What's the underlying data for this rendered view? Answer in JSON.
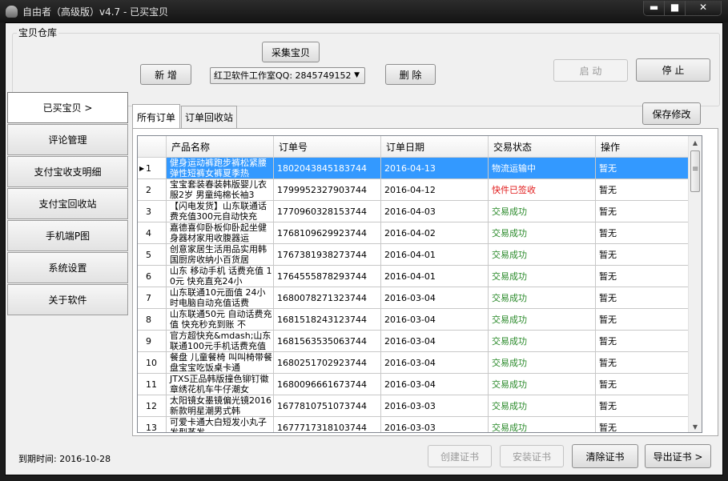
{
  "window": {
    "title": "自由者（高级版）v4.7 - 已买宝贝",
    "min_glyph": "▬",
    "max_glyph": "■",
    "close_glyph": "✕"
  },
  "header": {
    "group_title": "宝贝仓库",
    "collect_label": "采集宝贝",
    "add_label": "新 增",
    "shop_select_value": "红卫软件工作室QQ: 2845749152",
    "delete_label": "删 除",
    "start_label": "启 动",
    "stop_label": "停 止"
  },
  "sidebar": {
    "items": [
      {
        "label": "已买宝贝 >"
      },
      {
        "label": "评论管理"
      },
      {
        "label": "支付宝收支明细"
      },
      {
        "label": "支付宝回收站"
      },
      {
        "label": "手机端P图"
      },
      {
        "label": "系统设置"
      },
      {
        "label": "关于软件"
      }
    ],
    "active_index": 0
  },
  "tabs": [
    {
      "label": "所有订单"
    },
    {
      "label": "订单回收站"
    }
  ],
  "save_label": "保存修改",
  "grid": {
    "columns": [
      "产品名称",
      "订单号",
      "订单日期",
      "交易状态",
      "操作"
    ],
    "rows": [
      {
        "no": "1",
        "name": "健身运动裤跑步裤松紧腰弹性短裤女裤夏季热",
        "order": "1802043845183744",
        "date": "2016-04-13",
        "status": "物流运输中",
        "status_color": "green",
        "op": "暂无"
      },
      {
        "no": "2",
        "name": "宝宝套装春装韩版婴儿衣服2岁 男童纯棉长袖3",
        "order": "1799952327903744",
        "date": "2016-04-12",
        "status": "快件已签收",
        "status_color": "red",
        "op": "暂无"
      },
      {
        "no": "3",
        "name": "【闪电发货】山东联通话费充值300元自动快充",
        "order": "1770960328153744",
        "date": "2016-04-03",
        "status": "交易成功",
        "status_color": "green",
        "op": "暂无"
      },
      {
        "no": "4",
        "name": "嘉德喜仰卧板仰卧起坐健身器材家用收腹器运",
        "order": "1768109629923744",
        "date": "2016-04-02",
        "status": "交易成功",
        "status_color": "green",
        "op": "暂无"
      },
      {
        "no": "5",
        "name": "创意家居生活用品实用韩国厨房收纳小百货居",
        "order": "1767381938273744",
        "date": "2016-04-01",
        "status": "交易成功",
        "status_color": "green",
        "op": "暂无"
      },
      {
        "no": "6",
        "name": "山东  移动手机 话费充值 10元 快充直充24小",
        "order": "1764555878293744",
        "date": "2016-04-01",
        "status": "交易成功",
        "status_color": "green",
        "op": "暂无"
      },
      {
        "no": "7",
        "name": "山东联通10元面值 24小时电脑自动充值话费",
        "order": "1680078271323744",
        "date": "2016-03-04",
        "status": "交易成功",
        "status_color": "green",
        "op": "暂无"
      },
      {
        "no": "8",
        "name": "山东联通50元 自动话费充值 快充秒充到账 不",
        "order": "1681518243123744",
        "date": "2016-03-04",
        "status": "交易成功",
        "status_color": "green",
        "op": "暂无"
      },
      {
        "no": "9",
        "name": "官方超快充&mdash;山东联通100元手机话费充值",
        "order": "1681563535063744",
        "date": "2016-03-04",
        "status": "交易成功",
        "status_color": "green",
        "op": "暂无"
      },
      {
        "no": "10",
        "name": "餐盘 儿童餐椅 叫叫椅带餐盘宝宝吃饭桌卡通",
        "order": "1680251702923744",
        "date": "2016-03-04",
        "status": "交易成功",
        "status_color": "green",
        "op": "暂无"
      },
      {
        "no": "11",
        "name": "JTXS正品韩版撞色铆钉徽章绣花机车牛仔潮女",
        "order": "1680096661673744",
        "date": "2016-03-04",
        "status": "交易成功",
        "status_color": "green",
        "op": "暂无"
      },
      {
        "no": "12",
        "name": "太阳镜女墨镜偏光镜2016新款明星潮男式韩",
        "order": "1677810751073744",
        "date": "2016-03-03",
        "status": "交易成功",
        "status_color": "green",
        "op": "暂无"
      },
      {
        "no": "13",
        "name": "可爱卡通大白短发小丸子发型蒸发",
        "order": "1677717318103744",
        "date": "2016-03-03",
        "status": "交易成功",
        "status_color": "green",
        "op": "暂无"
      }
    ],
    "selected_index": 0
  },
  "footer": {
    "expire_label": "到期时间: 2016-10-28",
    "create_cert_label": "创建证书",
    "install_cert_label": "安装证书",
    "clear_cert_label": "清除证书",
    "export_cert_label": "导出证书 >"
  },
  "colors": {
    "selection": "#3399ff",
    "status_green": "#2a8a2a",
    "status_red": "#e11a1a"
  }
}
